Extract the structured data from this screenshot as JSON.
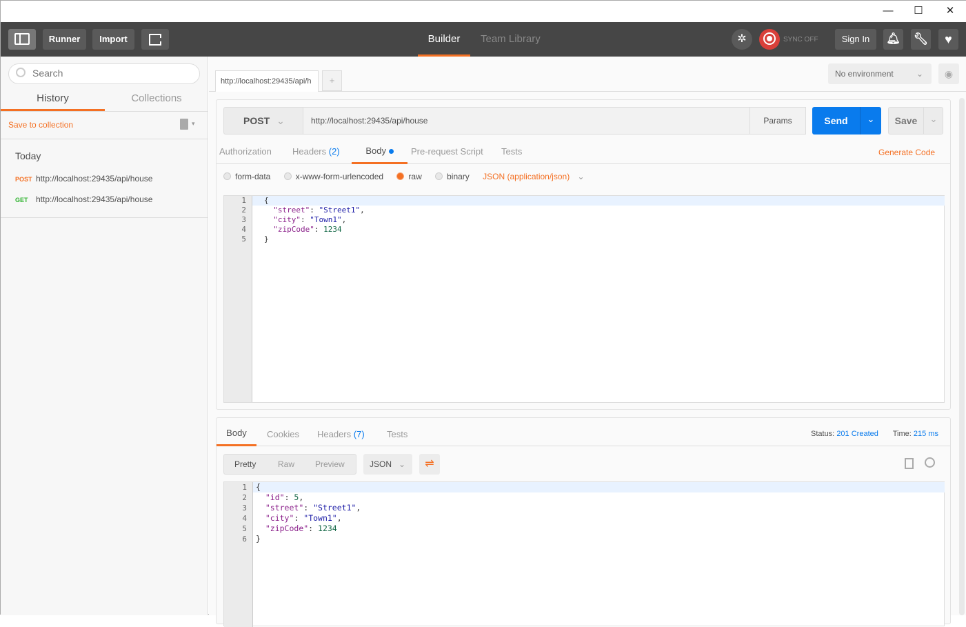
{
  "window": {
    "minimize": "—",
    "maximize": "☐",
    "close": "✕"
  },
  "header": {
    "runner": "Runner",
    "import": "Import",
    "tabs": [
      {
        "label": "Builder",
        "active": true
      },
      {
        "label": "Team Library",
        "active": false
      }
    ],
    "sync": "SYNC OFF",
    "sign_in": "Sign In"
  },
  "sidebar": {
    "search_placeholder": "Search",
    "tabs": [
      {
        "label": "History",
        "active": true
      },
      {
        "label": "Collections",
        "active": false
      }
    ],
    "save_to_collection": "Save to collection",
    "group": "Today",
    "history": [
      {
        "method": "POST",
        "url": "http://localhost:29435/api/house",
        "color": "#f47023"
      },
      {
        "method": "GET",
        "url": "http://localhost:29435/api/house",
        "color": "#2fb32f"
      }
    ]
  },
  "main": {
    "request_tab": "http://localhost:29435/api/h",
    "add_tab": "+",
    "environment": "No environment",
    "method": "POST",
    "url": "http://localhost:29435/api/house",
    "params": "Params",
    "send": "Send",
    "save": "Save",
    "req_tabs": [
      {
        "label": "Authorization",
        "count": ""
      },
      {
        "label": "Headers",
        "count": "(2)"
      },
      {
        "label": "Body",
        "count": "",
        "active": true
      },
      {
        "label": "Pre-request Script",
        "count": ""
      },
      {
        "label": "Tests",
        "count": ""
      }
    ],
    "generate_code": "Generate Code",
    "body_modes": [
      {
        "label": "form-data",
        "on": false
      },
      {
        "label": "x-www-form-urlencoded",
        "on": false
      },
      {
        "label": "raw",
        "on": true
      },
      {
        "label": "binary",
        "on": false
      }
    ],
    "content_type": "JSON (application/json)",
    "request_lines": [
      "1",
      "2",
      "3",
      "4",
      "5"
    ],
    "response_tabs": [
      {
        "label": "Body",
        "count": "",
        "active": true
      },
      {
        "label": "Cookies",
        "count": ""
      },
      {
        "label": "Headers",
        "count": "(7)"
      },
      {
        "label": "Tests",
        "count": ""
      }
    ],
    "status_label": "Status:",
    "status": "201 Created",
    "time_label": "Time:",
    "time": "215 ms",
    "view_modes": [
      "Pretty",
      "Raw",
      "Preview"
    ],
    "format": "JSON",
    "response_lines": [
      "1",
      "2",
      "3",
      "4",
      "5",
      "6"
    ]
  },
  "colors": {
    "accent": "#f47023",
    "send": "#097bed",
    "header": "#464646",
    "link": "#097bed"
  }
}
